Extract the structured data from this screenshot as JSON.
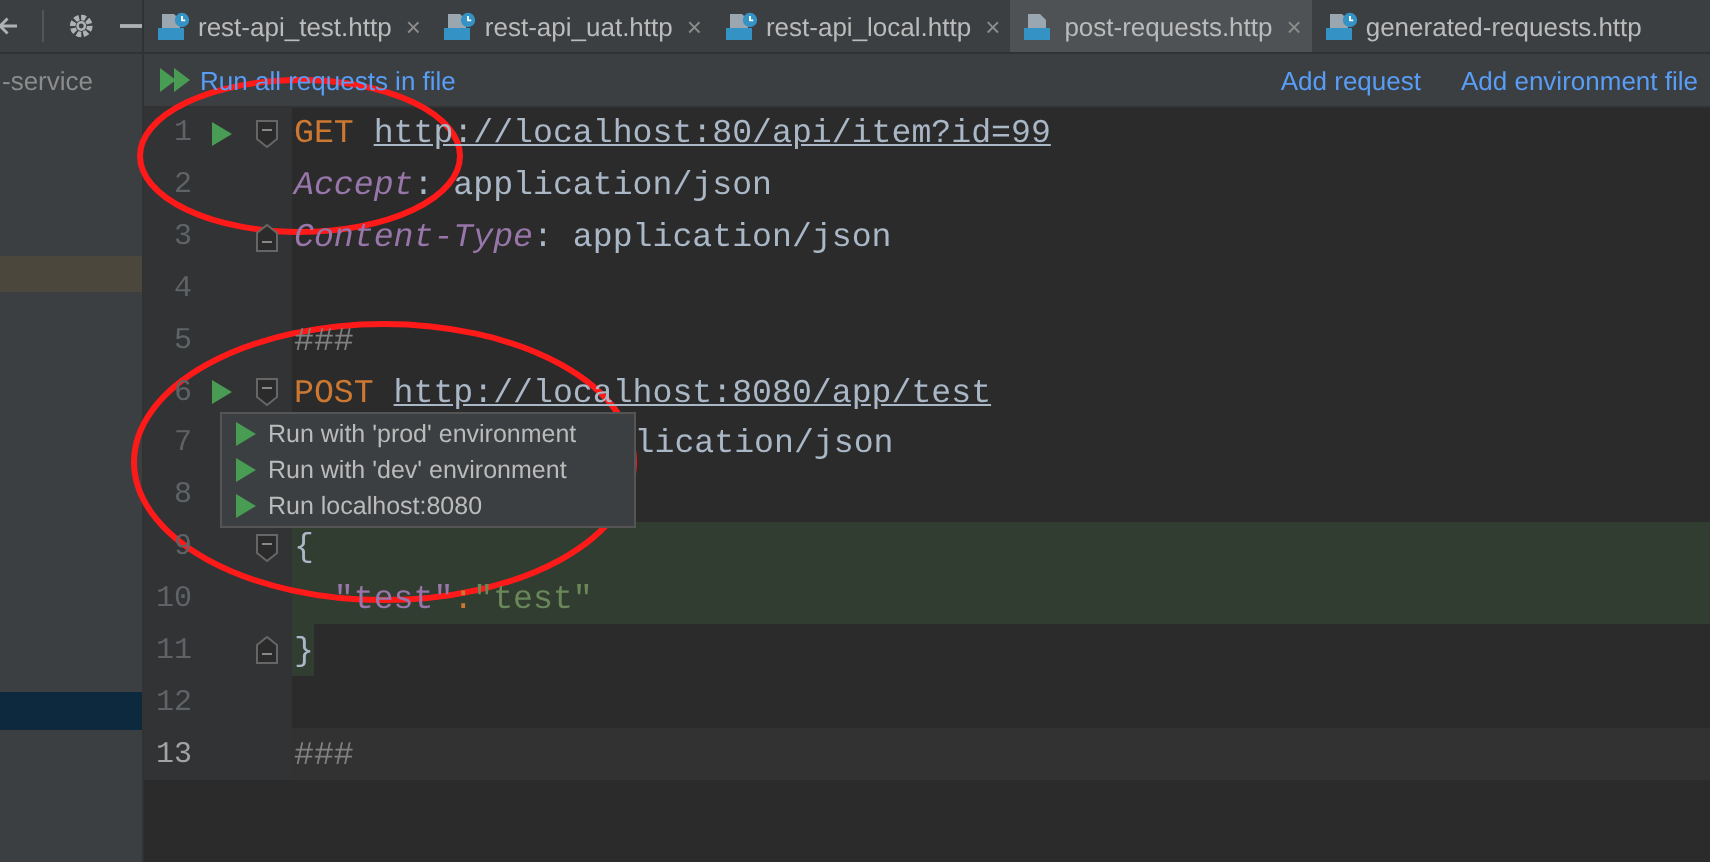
{
  "sidebar": {
    "label": "-service",
    "rows": [
      {
        "kind": "modified",
        "selected": false
      },
      {
        "kind": "current",
        "selected": true
      }
    ]
  },
  "tabs": [
    {
      "label": "rest-api_test.http",
      "kind": "clock",
      "close": "×",
      "selected": false
    },
    {
      "label": "rest-api_uat.http",
      "kind": "clock",
      "close": "×",
      "selected": false
    },
    {
      "label": "rest-api_local.http",
      "kind": "clock",
      "close": "×",
      "selected": false
    },
    {
      "label": "post-requests.http",
      "kind": "plain",
      "close": "×",
      "selected": true
    },
    {
      "label": "generated-requests.http",
      "kind": "clock",
      "selected": false
    }
  ],
  "toolbar": {
    "run_all": "Run all requests in file",
    "links": [
      "Add request",
      "Add environment file"
    ]
  },
  "editor": {
    "lines": [
      {
        "number": "1",
        "run": true,
        "fold_start": true,
        "tokens": [
          {
            "kind": "method",
            "text": "GET"
          },
          {
            "kind": "url",
            "text": "http://localhost:80/api/item?id=99"
          }
        ]
      },
      {
        "number": "2",
        "tokens": [
          {
            "kind": "header",
            "text": "Accept"
          },
          {
            "kind": "plain",
            "text": ": application/json"
          }
        ]
      },
      {
        "number": "3",
        "fold_end": true,
        "tokens": [
          {
            "kind": "header",
            "text": "Content-Type"
          },
          {
            "kind": "plain",
            "text": ": application/json"
          }
        ]
      },
      {
        "number": "4"
      },
      {
        "number": "5",
        "tokens": [
          {
            "kind": "separator",
            "text": "###"
          }
        ]
      },
      {
        "number": "6",
        "run": true,
        "fold_start": true,
        "tokens": [
          {
            "kind": "method",
            "text": "POST"
          },
          {
            "kind": "url",
            "text": "http://localhost:8080/app/test"
          }
        ]
      },
      {
        "number": "7",
        "covered": true,
        "tokens": [
          {
            "kind": "plain",
            "text": "lication/json"
          }
        ]
      },
      {
        "number": "8"
      },
      {
        "number": "9",
        "fold_start": true,
        "injected_block": true,
        "tokens": [
          {
            "kind": "plain",
            "text": "{"
          }
        ]
      },
      {
        "number": "10",
        "injected_block": true,
        "tokens": [
          {
            "kind": "json-key",
            "text": "\"test\""
          },
          {
            "kind": "punct",
            "text": ":"
          },
          {
            "kind": "json-string",
            "text": "\"test\""
          }
        ]
      },
      {
        "number": "11",
        "fold_end": true,
        "injected_tail": true,
        "tokens": [
          {
            "kind": "plain",
            "text": "}"
          }
        ]
      },
      {
        "number": "12"
      },
      {
        "number": "13",
        "current": true,
        "tokens": [
          {
            "kind": "separator",
            "text": "###"
          }
        ]
      }
    ]
  },
  "run_menu": {
    "items": [
      "Run with 'prod' environment",
      "Run with 'dev' environment",
      "Run localhost:8080"
    ]
  },
  "annotations": [
    {
      "kind": "ellipse"
    },
    {
      "kind": "ellipse"
    }
  ]
}
